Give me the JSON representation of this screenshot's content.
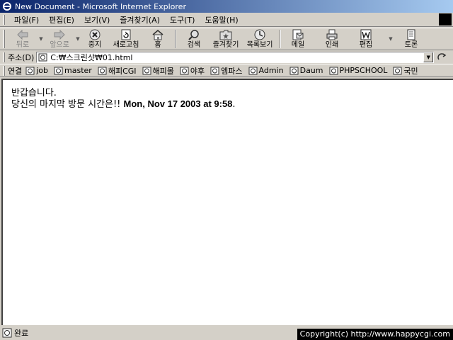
{
  "window": {
    "title": "New Document - Microsoft Internet Explorer"
  },
  "menu": {
    "items": [
      "파일(F)",
      "편집(E)",
      "보기(V)",
      "즐겨찾기(A)",
      "도구(T)",
      "도움말(H)"
    ]
  },
  "toolbar": {
    "back": "뒤로",
    "forward": "앞으로",
    "stop": "중지",
    "refresh": "새로고침",
    "home": "홈",
    "search": "검색",
    "favorites": "즐겨찾기",
    "history": "목록보기",
    "mail": "메일",
    "print": "인쇄",
    "edit": "편집",
    "discuss": "토론"
  },
  "address": {
    "label": "주소(D)",
    "url": "C:₩스크린샷₩01.html"
  },
  "links": {
    "label": "연결",
    "items": [
      "job",
      "master",
      "해피CGI",
      "해피몰",
      "야후",
      "엠파스",
      "Admin",
      "Daum",
      "PHPSCHOOL",
      "국민"
    ]
  },
  "page": {
    "line1": "반갑습니다.",
    "line2_prefix": "당신의 마지막 방문 시간은!! ",
    "visit_time": "Mon, Nov 17 2003 at 9:58",
    "line2_suffix": "."
  },
  "status": {
    "text": "완료"
  },
  "overlay": {
    "copyright": "Copyright(c) http://www.happycgi.com"
  }
}
